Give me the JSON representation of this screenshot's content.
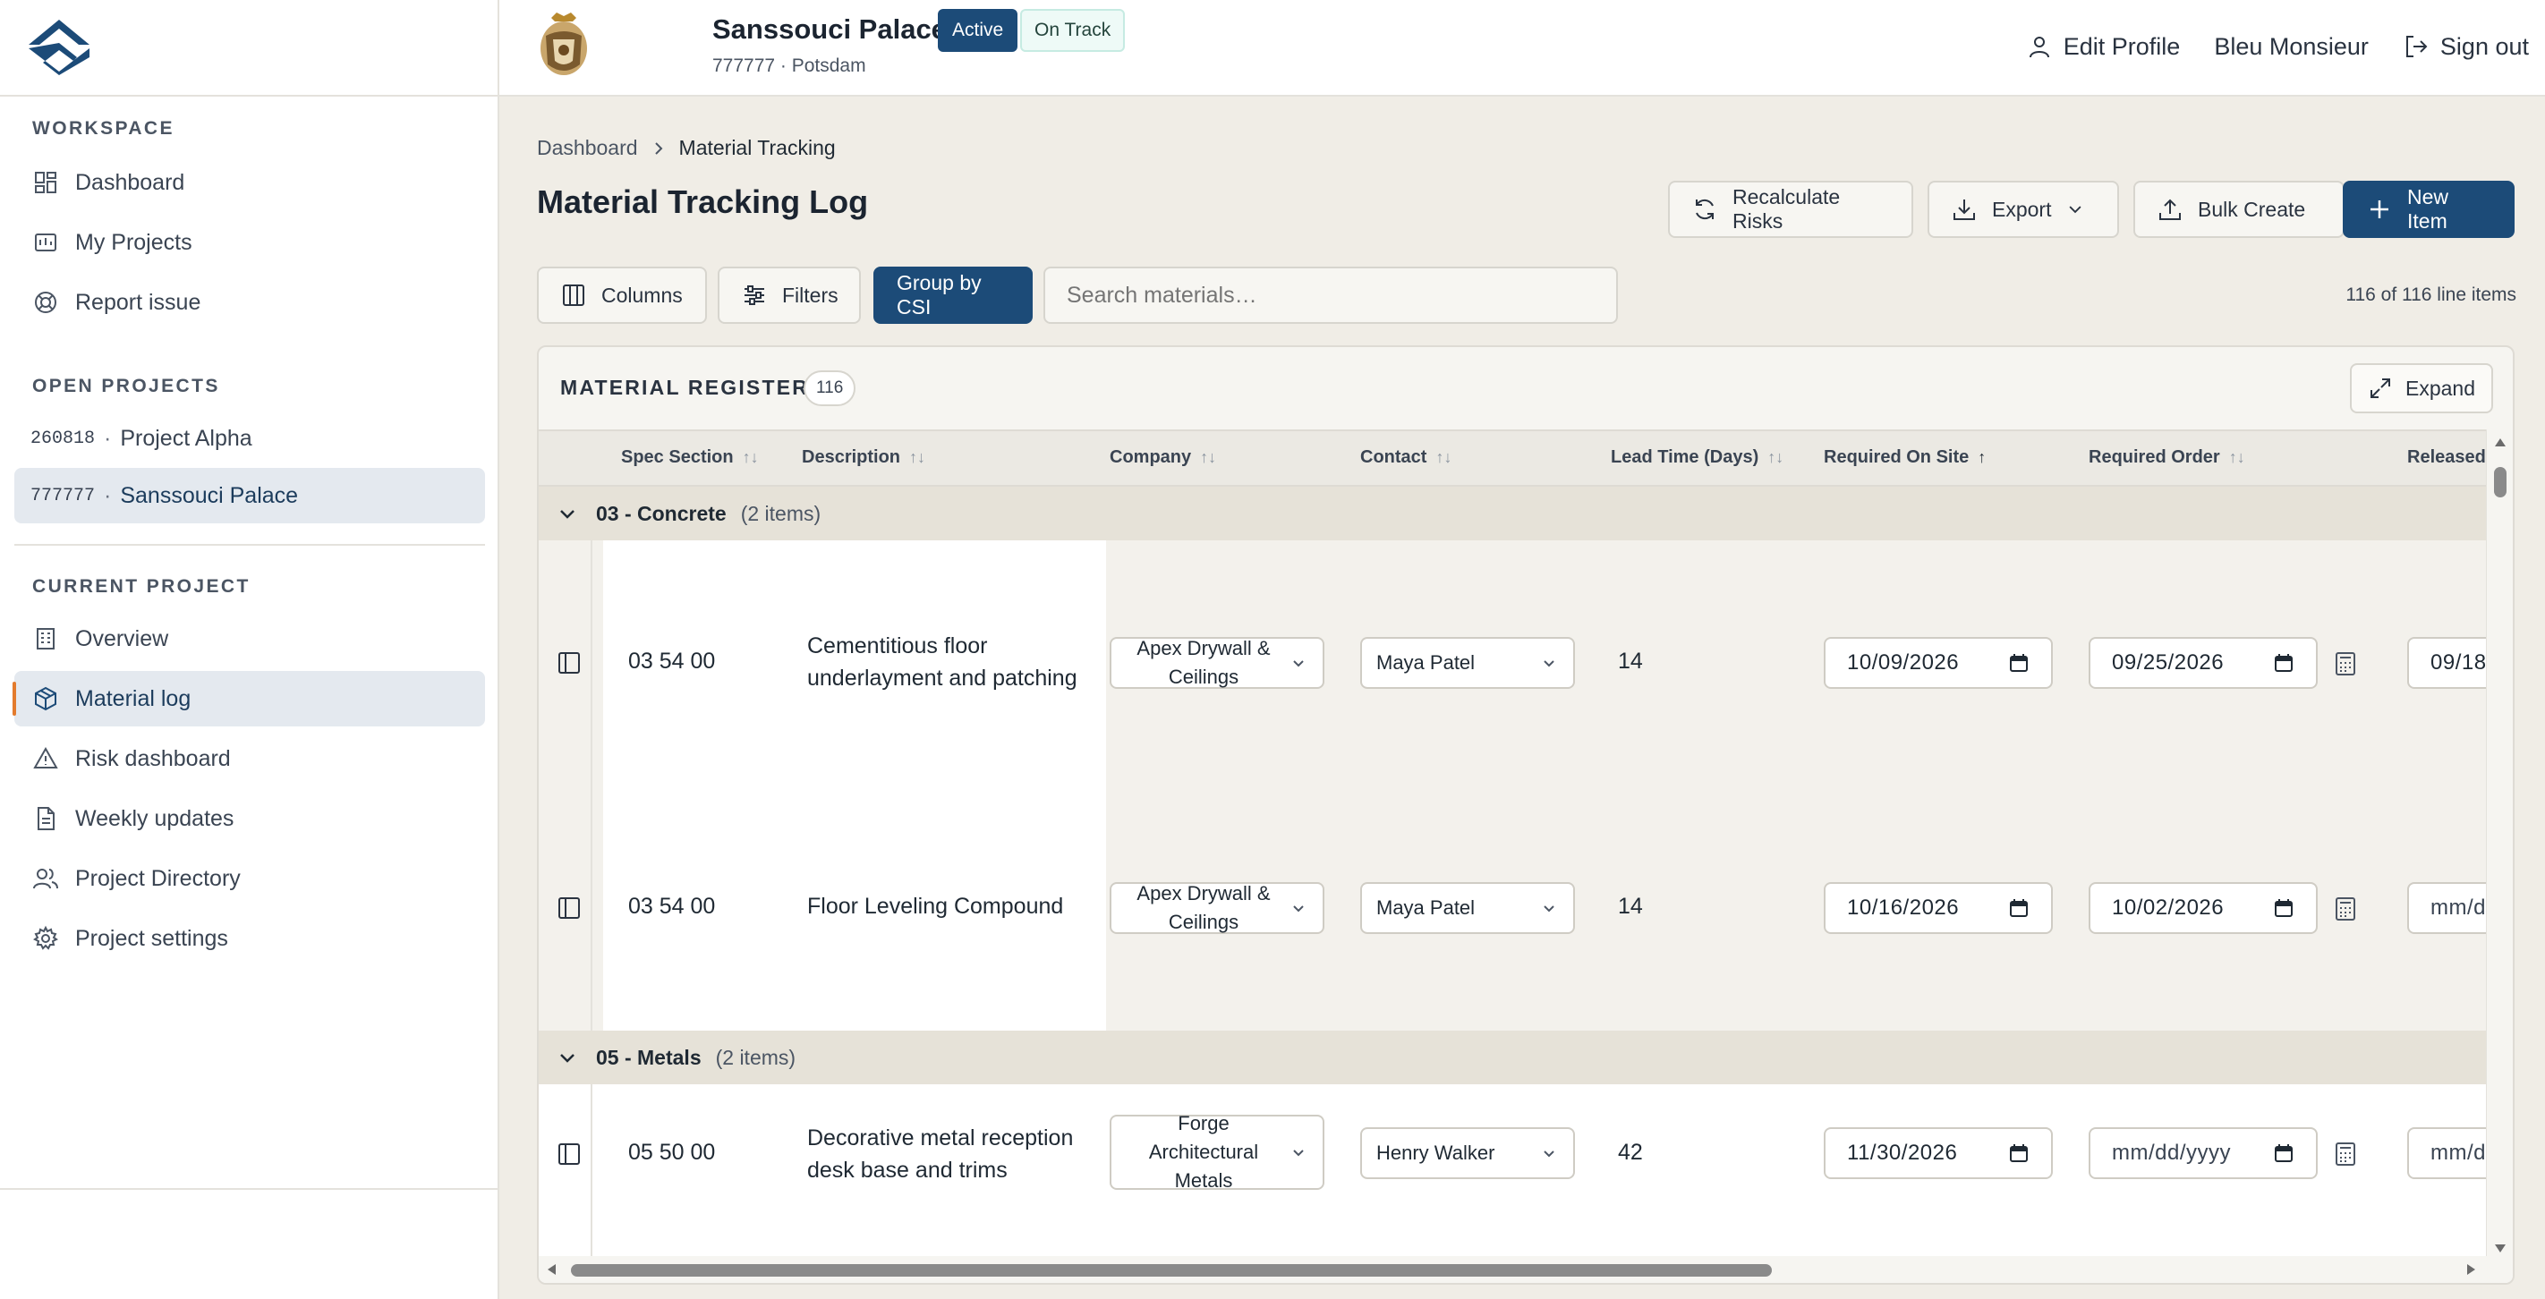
{
  "sidebar": {
    "workspace_heading": "WORKSPACE",
    "workspace_items": [
      {
        "label": "Dashboard",
        "icon": "dashboard-icon"
      },
      {
        "label": "My Projects",
        "icon": "folder-icon"
      },
      {
        "label": "Report issue",
        "icon": "lifebuoy-icon"
      }
    ],
    "open_projects_heading": "OPEN PROJECTS",
    "open_projects": [
      {
        "code": "260818",
        "name": "Project Alpha",
        "active": false
      },
      {
        "code": "777777",
        "name": "Sanssouci Palace",
        "active": true
      }
    ],
    "current_project_heading": "CURRENT PROJECT",
    "current_project_items": [
      {
        "label": "Overview",
        "icon": "building-icon",
        "active": false
      },
      {
        "label": "Material log",
        "icon": "box-icon",
        "active": true
      },
      {
        "label": "Risk dashboard",
        "icon": "warning-icon",
        "active": false
      },
      {
        "label": "Weekly updates",
        "icon": "document-icon",
        "active": false
      },
      {
        "label": "Project Directory",
        "icon": "users-icon",
        "active": false
      },
      {
        "label": "Project settings",
        "icon": "gear-icon",
        "active": false
      }
    ]
  },
  "topbar": {
    "project_name": "Sanssouci Palace",
    "project_code": "777777",
    "project_city": "Potsdam",
    "project_sub": "777777 · Potsdam",
    "status_badge": "Active",
    "track_badge": "On Track",
    "edit_profile": "Edit Profile",
    "user_name": "Bleu Monsieur",
    "sign_out": "Sign out"
  },
  "breadcrumb": {
    "root": "Dashboard",
    "current": "Material Tracking"
  },
  "page_title": "Material Tracking Log",
  "actions": {
    "recalculate": "Recalculate Risks",
    "export": "Export",
    "bulk_create": "Bulk Create",
    "new_item": "New Item"
  },
  "toolbar": {
    "columns": "Columns",
    "filters": "Filters",
    "group_by": "Group by CSI",
    "search_placeholder": "Search materials…",
    "line_count": "116 of 116 line items"
  },
  "register": {
    "title": "MATERIAL REGISTER",
    "count": "116",
    "expand": "Expand",
    "columns": [
      "Spec Section",
      "Description",
      "Company",
      "Contact",
      "Lead Time (Days)",
      "Required On Site",
      "Required Order",
      "Released"
    ],
    "sorted_column": "Required On Site",
    "groups": [
      {
        "name": "03 - Concrete",
        "count_label": "(2 items)",
        "rows": [
          {
            "spec": "03 54 00",
            "description": "Cementitious floor underlayment and patching",
            "company": "Apex Drywall & Ceilings",
            "contact": "Maya Patel",
            "lead_time": "14",
            "required_on_site": "10/09/2026",
            "required_order": "09/25/2026",
            "released": "09/18"
          },
          {
            "spec": "03 54 00",
            "description": "Floor Leveling Compound",
            "company": "Apex Drywall & Ceilings",
            "contact": "Maya Patel",
            "lead_time": "14",
            "required_on_site": "10/16/2026",
            "required_order": "10/02/2026",
            "released": "mm/d"
          }
        ]
      },
      {
        "name": "05 - Metals",
        "count_label": "(2 items)",
        "rows": [
          {
            "spec": "05 50 00",
            "description": "Decorative metal reception desk base and trims",
            "company": "Forge Architectural Metals",
            "contact": "Henry Walker",
            "lead_time": "42",
            "required_on_site": "11/30/2026",
            "required_order": "mm/dd/yyyy",
            "released": "mm/d"
          }
        ]
      }
    ]
  },
  "colors": {
    "primary": "#1c4b78",
    "active_nav": "#e4e9ef",
    "indicator": "#e37b2d",
    "group_row": "#e6e2d8",
    "background": "#f0ede6"
  }
}
